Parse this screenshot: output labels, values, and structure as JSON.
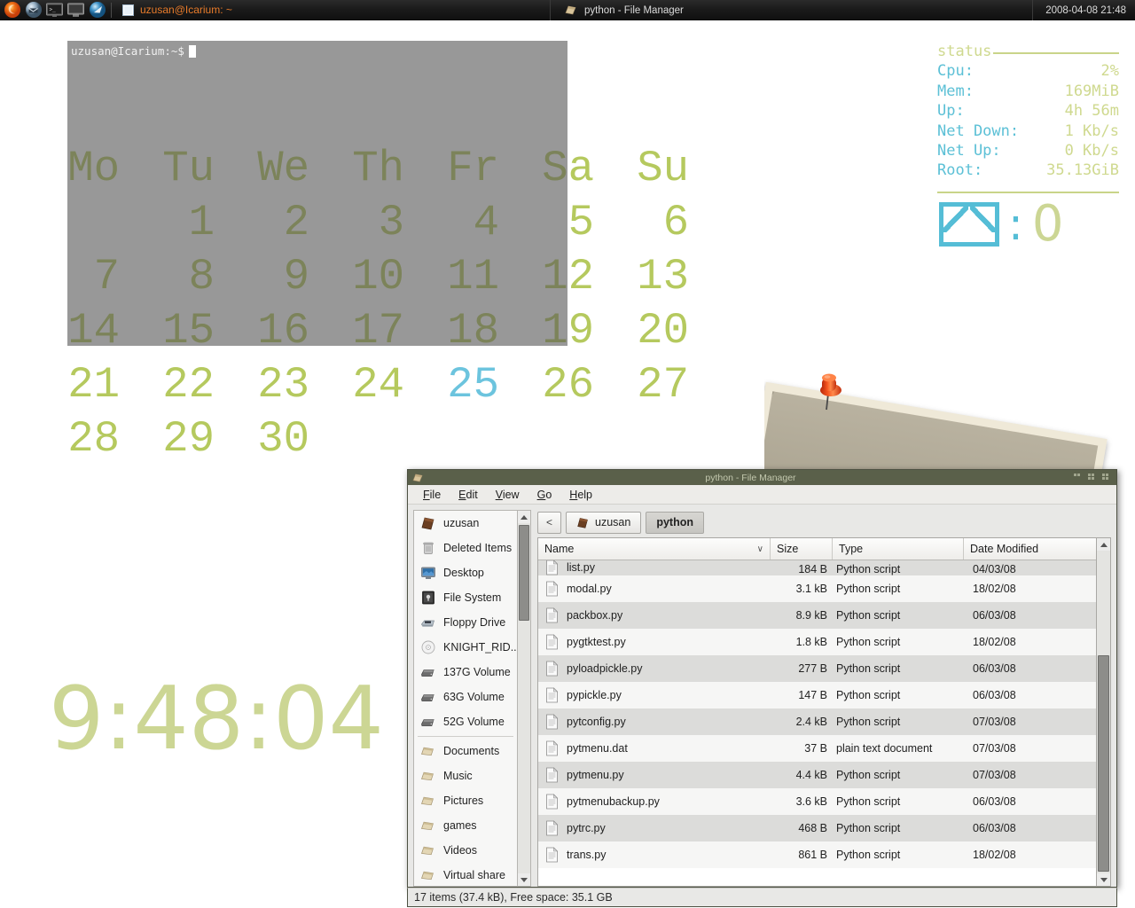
{
  "taskbar": {
    "launchers": [
      {
        "name": "firefox-icon",
        "label": "Firefox"
      },
      {
        "name": "mail-client-icon",
        "label": "Mail"
      },
      {
        "name": "terminal-icon",
        "label": "Terminal"
      },
      {
        "name": "display-icon",
        "label": "Display"
      },
      {
        "name": "media-player-icon",
        "label": "Media Player"
      }
    ],
    "window_button": "uzusan@Icarium: ~",
    "center_task": "python - File Manager",
    "datetime": "2008-04-08 21:48"
  },
  "calendar": {
    "weekdays": [
      "Mo",
      "Tu",
      "We",
      "Th",
      "Fr",
      "Sa",
      "Su"
    ],
    "weeks": [
      [
        "",
        "1",
        "2",
        "3",
        "4",
        "5",
        "6"
      ],
      [
        "7",
        "8",
        "9",
        "10",
        "11",
        "12",
        "13"
      ],
      [
        "14",
        "15",
        "16",
        "17",
        "18",
        "19",
        "20"
      ],
      [
        "21",
        "22",
        "23",
        "24",
        "25",
        "26",
        "27"
      ],
      [
        "28",
        "29",
        "30",
        "",
        "",
        "",
        ""
      ]
    ],
    "today": "25",
    "color_normal": "#b5c95e",
    "color_today": "#6cc4de"
  },
  "clock": {
    "time": "9:48:04",
    "color": "#ccd694"
  },
  "terminal": {
    "prompt": "uzusan@Icarium:~$"
  },
  "status_panel": {
    "heading": "status",
    "rows": [
      {
        "key": "Cpu:",
        "value": "2%"
      },
      {
        "key": "Mem:",
        "value": "169MiB"
      },
      {
        "key": "Up:",
        "value": "4h 56m"
      },
      {
        "key": "Net Down:",
        "value": "1 Kb/s"
      },
      {
        "key": "Net Up:",
        "value": "0 Kb/s"
      },
      {
        "key": "Root:",
        "value": "35.13GiB"
      }
    ],
    "mail_separator": ":",
    "mail_count": "0",
    "key_color": "#5cc0d6",
    "value_color": "#cfd98f"
  },
  "file_manager": {
    "title": "python - File Manager",
    "menus": [
      {
        "pre": "",
        "key": "F",
        "post": "ile"
      },
      {
        "pre": "",
        "key": "E",
        "post": "dit"
      },
      {
        "pre": "",
        "key": "V",
        "post": "iew"
      },
      {
        "pre": "",
        "key": "G",
        "post": "o"
      },
      {
        "pre": "",
        "key": "H",
        "post": "elp"
      }
    ],
    "window_buttons": [
      "minimize-button",
      "maximize-button",
      "close-button"
    ],
    "pathbar": {
      "back_label": "<",
      "crumbs": [
        {
          "label": "uzusan",
          "active": false,
          "icon": "home-folder-icon"
        },
        {
          "label": "python",
          "active": true,
          "icon": ""
        }
      ]
    },
    "sidebar": {
      "group1": [
        {
          "label": "uzusan",
          "icon": "home-folder-icon"
        },
        {
          "label": "Deleted Items",
          "icon": "trash-icon"
        },
        {
          "label": "Desktop",
          "icon": "desktop-icon"
        },
        {
          "label": "File System",
          "icon": "filesystem-icon"
        },
        {
          "label": "Floppy Drive",
          "icon": "floppy-icon"
        },
        {
          "label": "KNIGHT_RID...",
          "icon": "cdrom-icon"
        },
        {
          "label": "137G Volume",
          "icon": "harddisk-icon"
        },
        {
          "label": "63G Volume",
          "icon": "harddisk-icon"
        },
        {
          "label": "52G Volume",
          "icon": "harddisk-icon"
        }
      ],
      "group2": [
        {
          "label": "Documents",
          "icon": "folder-icon"
        },
        {
          "label": "Music",
          "icon": "folder-icon"
        },
        {
          "label": "Pictures",
          "icon": "folder-icon"
        },
        {
          "label": "games",
          "icon": "folder-icon"
        },
        {
          "label": "Videos",
          "icon": "folder-icon"
        },
        {
          "label": "Virtual share",
          "icon": "folder-icon"
        }
      ]
    },
    "columns": [
      "Name",
      "Size",
      "Type",
      "Date Modified"
    ],
    "sort_caret": "∨",
    "rows": [
      {
        "name": "list.py",
        "size": "184 B",
        "type": "Python script",
        "date": "04/03/08"
      },
      {
        "name": "modal.py",
        "size": "3.1 kB",
        "type": "Python script",
        "date": "18/02/08"
      },
      {
        "name": "packbox.py",
        "size": "8.9 kB",
        "type": "Python script",
        "date": "06/03/08"
      },
      {
        "name": "pygtktest.py",
        "size": "1.8 kB",
        "type": "Python script",
        "date": "18/02/08"
      },
      {
        "name": "pyloadpickle.py",
        "size": "277 B",
        "type": "Python script",
        "date": "06/03/08"
      },
      {
        "name": "pypickle.py",
        "size": "147 B",
        "type": "Python script",
        "date": "06/03/08"
      },
      {
        "name": "pytconfig.py",
        "size": "2.4 kB",
        "type": "Python script",
        "date": "07/03/08"
      },
      {
        "name": "pytmenu.dat",
        "size": "37 B",
        "type": "plain text document",
        "date": "07/03/08"
      },
      {
        "name": "pytmenu.py",
        "size": "4.4 kB",
        "type": "Python script",
        "date": "07/03/08"
      },
      {
        "name": "pytmenubackup.py",
        "size": "3.6 kB",
        "type": "Python script",
        "date": "06/03/08"
      },
      {
        "name": "pytrc.py",
        "size": "468 B",
        "type": "Python script",
        "date": "06/03/08"
      },
      {
        "name": "trans.py",
        "size": "861 B",
        "type": "Python script",
        "date": "18/02/08"
      }
    ],
    "statusbar": "17 items (37.4 kB), Free space: 35.1 GB"
  },
  "desktop": {
    "photo": {
      "name": "pinned-photo",
      "pin": "pushpin-icon"
    }
  }
}
